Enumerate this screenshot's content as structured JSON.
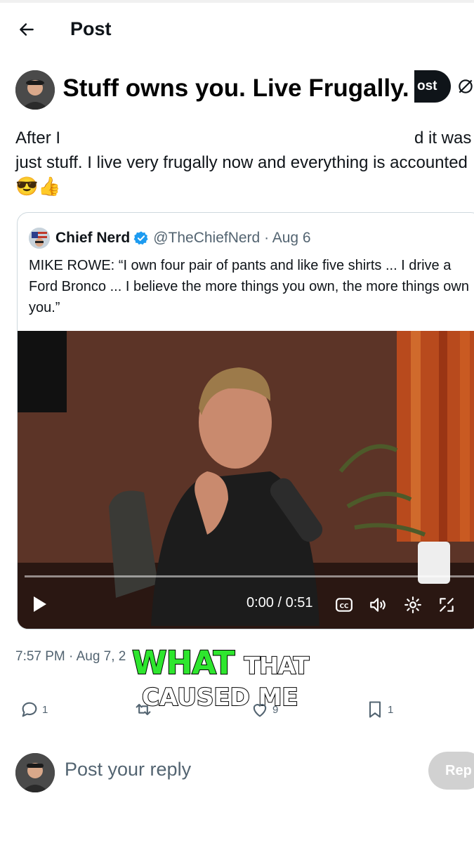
{
  "header": {
    "title": "Post",
    "back_icon": "arrow-left-icon"
  },
  "overlay": {
    "title": "Stuff owns you. Live Frugally."
  },
  "post": {
    "follow_label": "ost",
    "text_line1_left": "After I",
    "text_line1_right": "d it was",
    "text_line2": "just stuff. I live very frugally now and everything is accounted",
    "emojis": "😎👍"
  },
  "quote": {
    "author_name": "Chief Nerd",
    "handle_date": "@TheChiefNerd · Aug 6",
    "text": "MIKE ROWE: “I own four pair of pants and like five shirts ... I drive a Ford Bronco ... I believe the more things you own, the more things own you.”",
    "video": {
      "time": "0:00 / 0:51",
      "progress": 0
    }
  },
  "meta": {
    "timestamp": "7:57 PM · Aug 7, 2"
  },
  "captions": {
    "highlight": "WHAT",
    "line1_rest": "THAT",
    "line2": "CAUSED ME"
  },
  "actions": {
    "replies": "1",
    "likes": "9",
    "bookmarks": "1"
  },
  "reply": {
    "placeholder": "Post your reply",
    "button": "Rep"
  },
  "colors": {
    "caption_green": "#2ee62e",
    "text_primary": "#0f1419",
    "text_secondary": "#536471",
    "verified_blue": "#1d9bf0"
  }
}
